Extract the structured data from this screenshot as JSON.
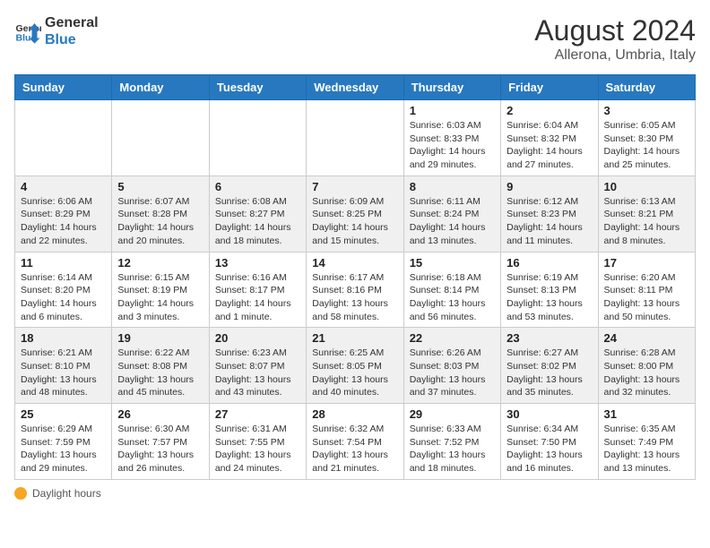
{
  "logo": {
    "line1": "General",
    "line2": "Blue"
  },
  "title": "August 2024",
  "location": "Allerona, Umbria, Italy",
  "days_of_week": [
    "Sunday",
    "Monday",
    "Tuesday",
    "Wednesday",
    "Thursday",
    "Friday",
    "Saturday"
  ],
  "footer_label": "Daylight hours",
  "weeks": [
    [
      {
        "day": "",
        "info": ""
      },
      {
        "day": "",
        "info": ""
      },
      {
        "day": "",
        "info": ""
      },
      {
        "day": "",
        "info": ""
      },
      {
        "day": "1",
        "info": "Sunrise: 6:03 AM\nSunset: 8:33 PM\nDaylight: 14 hours and 29 minutes."
      },
      {
        "day": "2",
        "info": "Sunrise: 6:04 AM\nSunset: 8:32 PM\nDaylight: 14 hours and 27 minutes."
      },
      {
        "day": "3",
        "info": "Sunrise: 6:05 AM\nSunset: 8:30 PM\nDaylight: 14 hours and 25 minutes."
      }
    ],
    [
      {
        "day": "4",
        "info": "Sunrise: 6:06 AM\nSunset: 8:29 PM\nDaylight: 14 hours and 22 minutes."
      },
      {
        "day": "5",
        "info": "Sunrise: 6:07 AM\nSunset: 8:28 PM\nDaylight: 14 hours and 20 minutes."
      },
      {
        "day": "6",
        "info": "Sunrise: 6:08 AM\nSunset: 8:27 PM\nDaylight: 14 hours and 18 minutes."
      },
      {
        "day": "7",
        "info": "Sunrise: 6:09 AM\nSunset: 8:25 PM\nDaylight: 14 hours and 15 minutes."
      },
      {
        "day": "8",
        "info": "Sunrise: 6:11 AM\nSunset: 8:24 PM\nDaylight: 14 hours and 13 minutes."
      },
      {
        "day": "9",
        "info": "Sunrise: 6:12 AM\nSunset: 8:23 PM\nDaylight: 14 hours and 11 minutes."
      },
      {
        "day": "10",
        "info": "Sunrise: 6:13 AM\nSunset: 8:21 PM\nDaylight: 14 hours and 8 minutes."
      }
    ],
    [
      {
        "day": "11",
        "info": "Sunrise: 6:14 AM\nSunset: 8:20 PM\nDaylight: 14 hours and 6 minutes."
      },
      {
        "day": "12",
        "info": "Sunrise: 6:15 AM\nSunset: 8:19 PM\nDaylight: 14 hours and 3 minutes."
      },
      {
        "day": "13",
        "info": "Sunrise: 6:16 AM\nSunset: 8:17 PM\nDaylight: 14 hours and 1 minute."
      },
      {
        "day": "14",
        "info": "Sunrise: 6:17 AM\nSunset: 8:16 PM\nDaylight: 13 hours and 58 minutes."
      },
      {
        "day": "15",
        "info": "Sunrise: 6:18 AM\nSunset: 8:14 PM\nDaylight: 13 hours and 56 minutes."
      },
      {
        "day": "16",
        "info": "Sunrise: 6:19 AM\nSunset: 8:13 PM\nDaylight: 13 hours and 53 minutes."
      },
      {
        "day": "17",
        "info": "Sunrise: 6:20 AM\nSunset: 8:11 PM\nDaylight: 13 hours and 50 minutes."
      }
    ],
    [
      {
        "day": "18",
        "info": "Sunrise: 6:21 AM\nSunset: 8:10 PM\nDaylight: 13 hours and 48 minutes."
      },
      {
        "day": "19",
        "info": "Sunrise: 6:22 AM\nSunset: 8:08 PM\nDaylight: 13 hours and 45 minutes."
      },
      {
        "day": "20",
        "info": "Sunrise: 6:23 AM\nSunset: 8:07 PM\nDaylight: 13 hours and 43 minutes."
      },
      {
        "day": "21",
        "info": "Sunrise: 6:25 AM\nSunset: 8:05 PM\nDaylight: 13 hours and 40 minutes."
      },
      {
        "day": "22",
        "info": "Sunrise: 6:26 AM\nSunset: 8:03 PM\nDaylight: 13 hours and 37 minutes."
      },
      {
        "day": "23",
        "info": "Sunrise: 6:27 AM\nSunset: 8:02 PM\nDaylight: 13 hours and 35 minutes."
      },
      {
        "day": "24",
        "info": "Sunrise: 6:28 AM\nSunset: 8:00 PM\nDaylight: 13 hours and 32 minutes."
      }
    ],
    [
      {
        "day": "25",
        "info": "Sunrise: 6:29 AM\nSunset: 7:59 PM\nDaylight: 13 hours and 29 minutes."
      },
      {
        "day": "26",
        "info": "Sunrise: 6:30 AM\nSunset: 7:57 PM\nDaylight: 13 hours and 26 minutes."
      },
      {
        "day": "27",
        "info": "Sunrise: 6:31 AM\nSunset: 7:55 PM\nDaylight: 13 hours and 24 minutes."
      },
      {
        "day": "28",
        "info": "Sunrise: 6:32 AM\nSunset: 7:54 PM\nDaylight: 13 hours and 21 minutes."
      },
      {
        "day": "29",
        "info": "Sunrise: 6:33 AM\nSunset: 7:52 PM\nDaylight: 13 hours and 18 minutes."
      },
      {
        "day": "30",
        "info": "Sunrise: 6:34 AM\nSunset: 7:50 PM\nDaylight: 13 hours and 16 minutes."
      },
      {
        "day": "31",
        "info": "Sunrise: 6:35 AM\nSunset: 7:49 PM\nDaylight: 13 hours and 13 minutes."
      }
    ]
  ]
}
